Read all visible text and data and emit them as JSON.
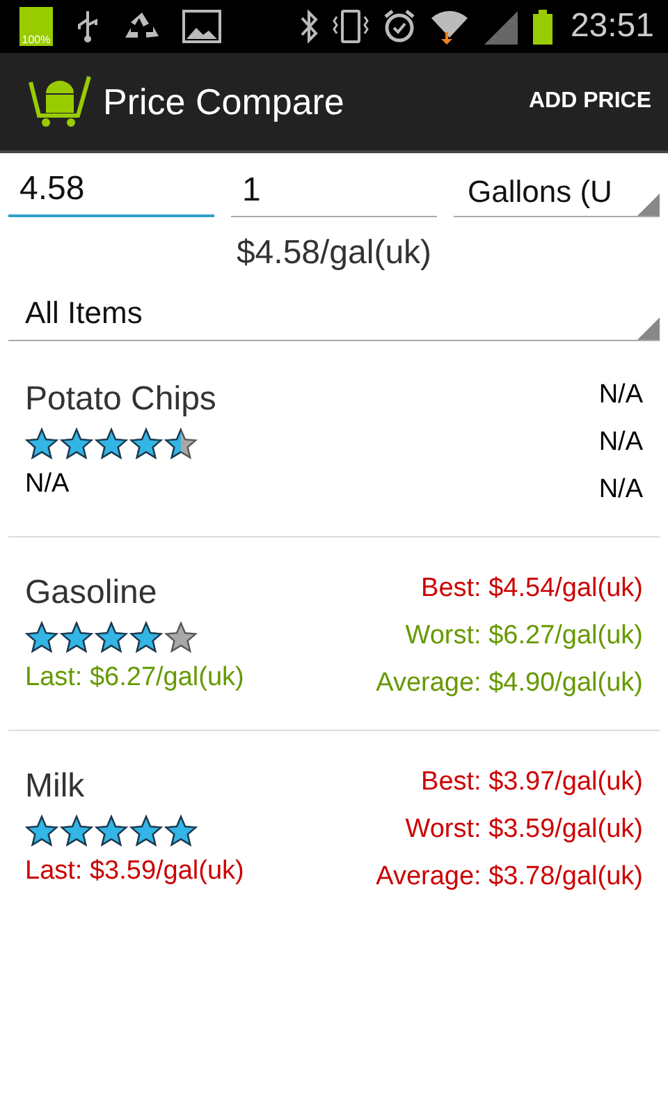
{
  "status_bar": {
    "battery_label": "100%",
    "time": "23:51"
  },
  "action_bar": {
    "title": "Price Compare",
    "action": "ADD PRICE"
  },
  "form": {
    "fields": [
      {
        "value": "4.58",
        "focused": true
      },
      {
        "value": "1",
        "focused": false
      }
    ],
    "unit": "Gallons (U",
    "unit_price": "$4.58/gal(uk)",
    "filter": "All Items"
  },
  "items": [
    {
      "name": "Potato Chips",
      "stars": 4.5,
      "last": {
        "text": "N/A",
        "color": "#000000"
      },
      "stats": [
        {
          "text": "N/A",
          "color": "#000000"
        },
        {
          "text": "N/A",
          "color": "#000000"
        },
        {
          "text": "N/A",
          "color": "#000000"
        }
      ]
    },
    {
      "name": "Gasoline",
      "stars": 4,
      "last": {
        "text": "Last: $6.27/gal(uk)",
        "color": "#669900"
      },
      "stats": [
        {
          "text": "Best: $4.54/gal(uk)",
          "color": "#cc0000"
        },
        {
          "text": "Worst: $6.27/gal(uk)",
          "color": "#669900"
        },
        {
          "text": "Average: $4.90/gal(uk)",
          "color": "#669900"
        }
      ]
    },
    {
      "name": "Milk",
      "stars": 5,
      "last": {
        "text": "Last: $3.59/gal(uk)",
        "color": "#cc0000"
      },
      "stats": [
        {
          "text": "Best: $3.97/gal(uk)",
          "color": "#cc0000"
        },
        {
          "text": "Worst: $3.59/gal(uk)",
          "color": "#cc0000"
        },
        {
          "text": "Average: $3.78/gal(uk)",
          "color": "#cc0000"
        }
      ]
    }
  ]
}
